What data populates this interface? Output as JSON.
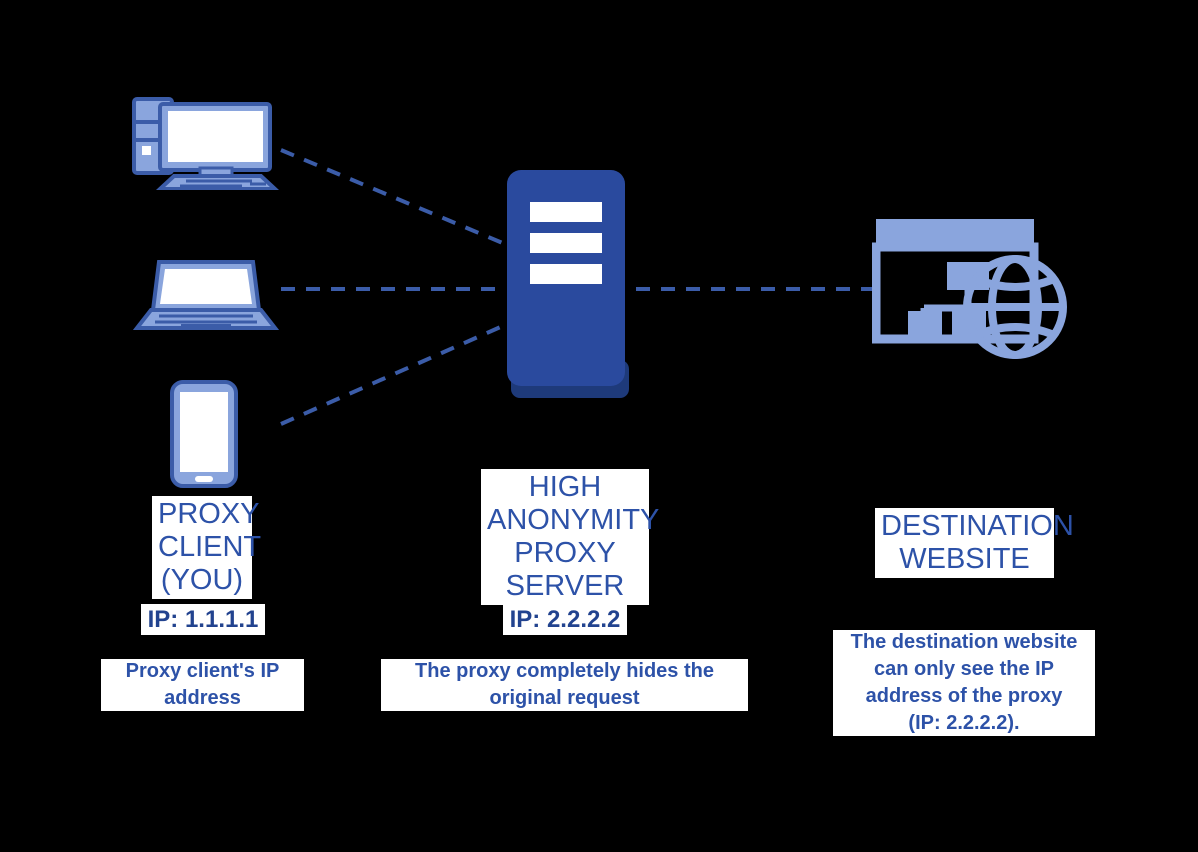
{
  "diagram": {
    "title": "High Anonymity Proxy Server Flow",
    "background_color": "#000000",
    "colors": {
      "light_blue": "#8aa5dd",
      "mid_blue": "#3b5ca8",
      "dark_blue": "#2a4a9e",
      "server_shadow": "#1e3a7a",
      "text_blue": "#2d52a8",
      "ip_blue": "#22438f",
      "white": "#ffffff"
    }
  },
  "columns": {
    "client": {
      "label": "PROXY\nCLIENT\n(YOU)",
      "ip": "IP: 1.1.1.1",
      "caption": "Proxy client's IP\naddress",
      "devices": [
        {
          "name": "desktop-computer-icon"
        },
        {
          "name": "laptop-icon"
        },
        {
          "name": "smartphone-icon"
        }
      ]
    },
    "proxy": {
      "label": "HIGH\nANONYMITY\nPROXY\nSERVER",
      "ip": "IP: 2.2.2.2",
      "caption": "The proxy completely hides the\noriginal request",
      "device": {
        "name": "server-icon"
      }
    },
    "destination": {
      "label": "DESTINATION\nWEBSITE",
      "caption_line1": "The destination website",
      "caption_line2": "can only see the IP",
      "caption_line3": "address of the proxy",
      "caption_line4": "(IP: 2.2.2.2).",
      "device": {
        "name": "website-globe-icon"
      }
    }
  },
  "connections": [
    {
      "name": "desktop-to-proxy",
      "style": "dashed"
    },
    {
      "name": "laptop-to-proxy",
      "style": "dashed"
    },
    {
      "name": "phone-to-proxy",
      "style": "dashed"
    },
    {
      "name": "proxy-to-destination",
      "style": "dashed"
    }
  ]
}
